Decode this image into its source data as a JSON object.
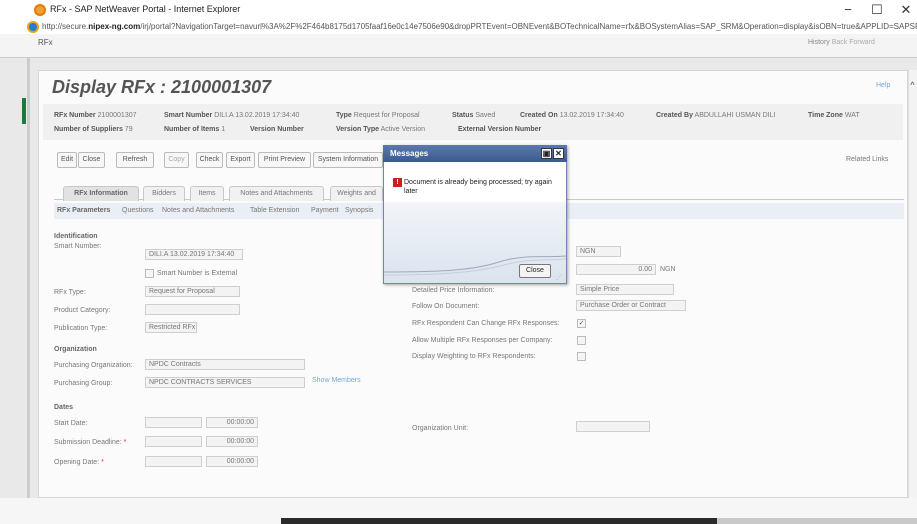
{
  "window": {
    "title": "RFx - SAP NetWeaver Portal - Internet Explorer",
    "minimize_glyph": "−",
    "maximize_glyph": "☐",
    "close_glyph": "✕",
    "url_prefix": "http://secure.",
    "url_domain": "nipex-ng.com",
    "url_rest": "/irj/portal?NavigationTarget=navurl%3A%2F%2F464b8175d1705faaf16e0c14e7506e90&dropPRTEvent=OBNEvent&BOTechnicalName=rfx&BOSystemAlias=SAP_SRM&Operation=display&isOBN=true&APPLID=SAPSRM"
  },
  "portal": {
    "title": "RFx",
    "history": "History",
    "back": "Back",
    "forward": "Forward"
  },
  "page": {
    "title": "Display RFx : 2100001307",
    "help": "Help"
  },
  "header": {
    "rfx_number_label": "RFx Number",
    "rfx_number": "2100001307",
    "smart_number_label": "Smart Number",
    "smart_number": "DILI.A 13.02.2019 17:34:40",
    "type_label": "Type",
    "type": "Request for Proposal",
    "status_label": "Status",
    "status": "Saved",
    "created_on_label": "Created On",
    "created_on": "13.02.2019 17:34:40",
    "created_by_label": "Created By",
    "created_by": "ABDULLAHI USMAN DILI",
    "time_zone_label": "Time Zone",
    "time_zone": "WAT",
    "suppliers_label": "Number of Suppliers",
    "suppliers": "79",
    "items_label": "Number of Items",
    "items": "1",
    "version_number_label": "Version Number",
    "version_type_label": "Version Type",
    "version_type": "Active Version",
    "external_version_label": "External Version Number"
  },
  "toolbar": {
    "edit": "Edit",
    "close": "Close",
    "refresh": "Refresh",
    "copy": "Copy",
    "check": "Check",
    "export": "Export",
    "print_preview": "Print Preview",
    "system_information": "System Information",
    "related_links": "Related Links"
  },
  "tabs": [
    "RFx Information",
    "Bidders",
    "Items",
    "Notes and Attachments",
    "Weights and"
  ],
  "subtabs": [
    "RFx Parameters",
    "Questions",
    "Notes and Attachments",
    "Table Extension",
    "Payment",
    "Synopsis"
  ],
  "form": {
    "identification": "Identification",
    "smart_number_label": "Smart Number:",
    "smart_number_value": "DILI.A 13.02.2019 17:34:40",
    "smart_external": "Smart Number is External",
    "rfx_type_label": "RFx Type:",
    "rfx_type_value": "Request for Proposal",
    "product_category_label": "Product Category:",
    "publication_type_label": "Publication Type:",
    "publication_type_value": "Restricted RFx",
    "organization": "Organization",
    "purchasing_org_label": "Purchasing Organization:",
    "purchasing_org_value": "NPDC Contracts",
    "purchasing_group_label": "Purchasing Group:",
    "purchasing_group_value": "NPDC CONTRACTS SERVICES",
    "show_members": "Show Members",
    "dates": "Dates",
    "start_date_label": "Start Date:",
    "start_time": "00:00:00",
    "submission_deadline_label": "Submission Deadline:",
    "submission_time": "00:00:00",
    "opening_date_label": "Opening Date:",
    "opening_time": "00:00:00",
    "required_mark": "*",
    "currency_value": "NGN",
    "amount_value": "0.00",
    "amount_currency": "NGN",
    "detailed_price_label": "Detailed Price Information:",
    "detailed_price_value": "Simple Price",
    "follow_on_label": "Follow On Document:",
    "follow_on_value": "Purchase Order or Contract",
    "change_responses_label": "RFx Respondent Can Change RFx Responses:",
    "allow_multiple_label": "Allow Multiple RFx Responses per Company:",
    "display_weighting_label": "Display Weighting to RFx Respondents:",
    "organization_unit_label": "Organization Unit:",
    "check_mark": "✓"
  },
  "dialog": {
    "title": "Messages",
    "message": "Document is already being processed; try again later",
    "close": "Close",
    "error_glyph": "!",
    "window_btn_glyph": "▣",
    "close_glyph": "✕"
  }
}
